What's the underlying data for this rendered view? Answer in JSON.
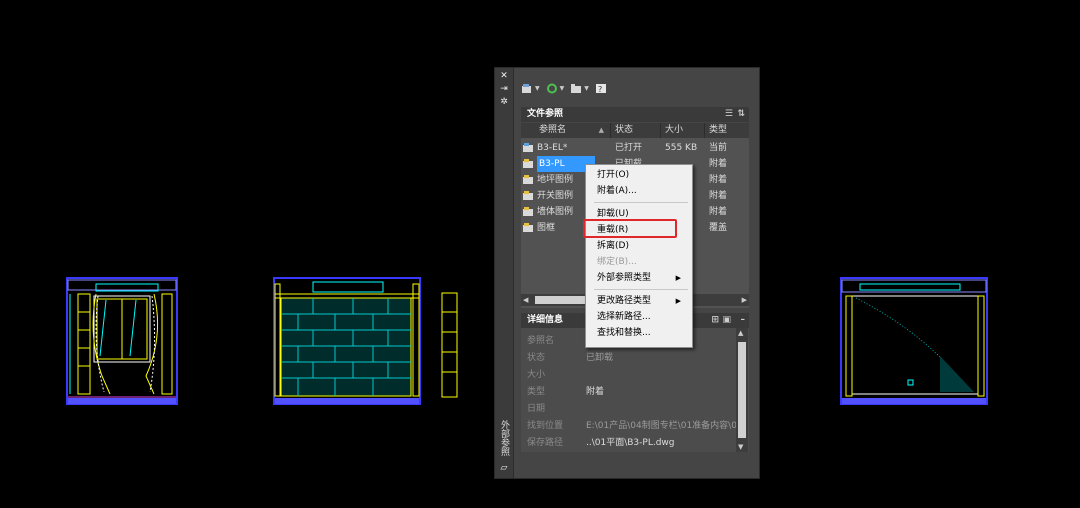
{
  "colors": {
    "background": "#000000",
    "palette": "#454545",
    "menu": "#f0f0f0",
    "highlight": "#e0272b",
    "selection": "#3399ff"
  },
  "palette": {
    "vertical_title": "外部参照",
    "strip_icons": [
      "close-icon",
      "autohide-icon",
      "properties-icon"
    ],
    "toolbar_icons": [
      "attach-dwg-icon",
      "refresh-icon",
      "change-path-icon",
      "help-icon"
    ],
    "file_refs": {
      "title": "文件参照",
      "columns": [
        "参照名",
        "状态",
        "大小",
        "类型"
      ],
      "rows": [
        {
          "name": "B3-EL*",
          "status": "已打开",
          "size": "555 KB",
          "type": "当前",
          "selected": false
        },
        {
          "name": "B3-PL",
          "status": "已卸载",
          "size": "",
          "type": "附着",
          "selected": true
        },
        {
          "name": "地坪图例",
          "status": "",
          "size": "",
          "type": "附着",
          "selected": false
        },
        {
          "name": "开关图例",
          "status": "",
          "size": "",
          "type": "附着",
          "selected": false
        },
        {
          "name": "墙体图例",
          "status": "",
          "size": "",
          "type": "附着",
          "selected": false
        },
        {
          "name": "图框",
          "status": "",
          "size": "B",
          "type": "覆盖",
          "selected": false
        }
      ]
    },
    "details": {
      "title": "详细信息",
      "rows": [
        {
          "label": "参照名",
          "value": ""
        },
        {
          "label": "状态",
          "value": "已卸载"
        },
        {
          "label": "大小",
          "value": ""
        },
        {
          "label": "类型",
          "value": "附着"
        },
        {
          "label": "日期",
          "value": ""
        },
        {
          "label": "找到位置",
          "value": "E:\\01产品\\04制图专栏\\01准备内容\\0"
        },
        {
          "label": "保存路径",
          "value": "..\\01平面\\B3-PL.dwg"
        }
      ]
    }
  },
  "context_menu": {
    "items": [
      {
        "label": "打开(O)",
        "disabled": false
      },
      {
        "label": "附着(A)...",
        "disabled": false
      },
      {
        "label": "卸载(U)",
        "disabled": false
      },
      {
        "label": "重载(R)",
        "disabled": false
      },
      {
        "label": "拆离(D)",
        "disabled": false
      },
      {
        "label": "绑定(B)...",
        "disabled": true
      },
      {
        "label": "外部参照类型",
        "disabled": false
      },
      {
        "label": "更改路径类型",
        "disabled": false
      },
      {
        "label": "选择新路径...",
        "disabled": false
      },
      {
        "label": "查找和替换...",
        "disabled": false
      }
    ]
  }
}
